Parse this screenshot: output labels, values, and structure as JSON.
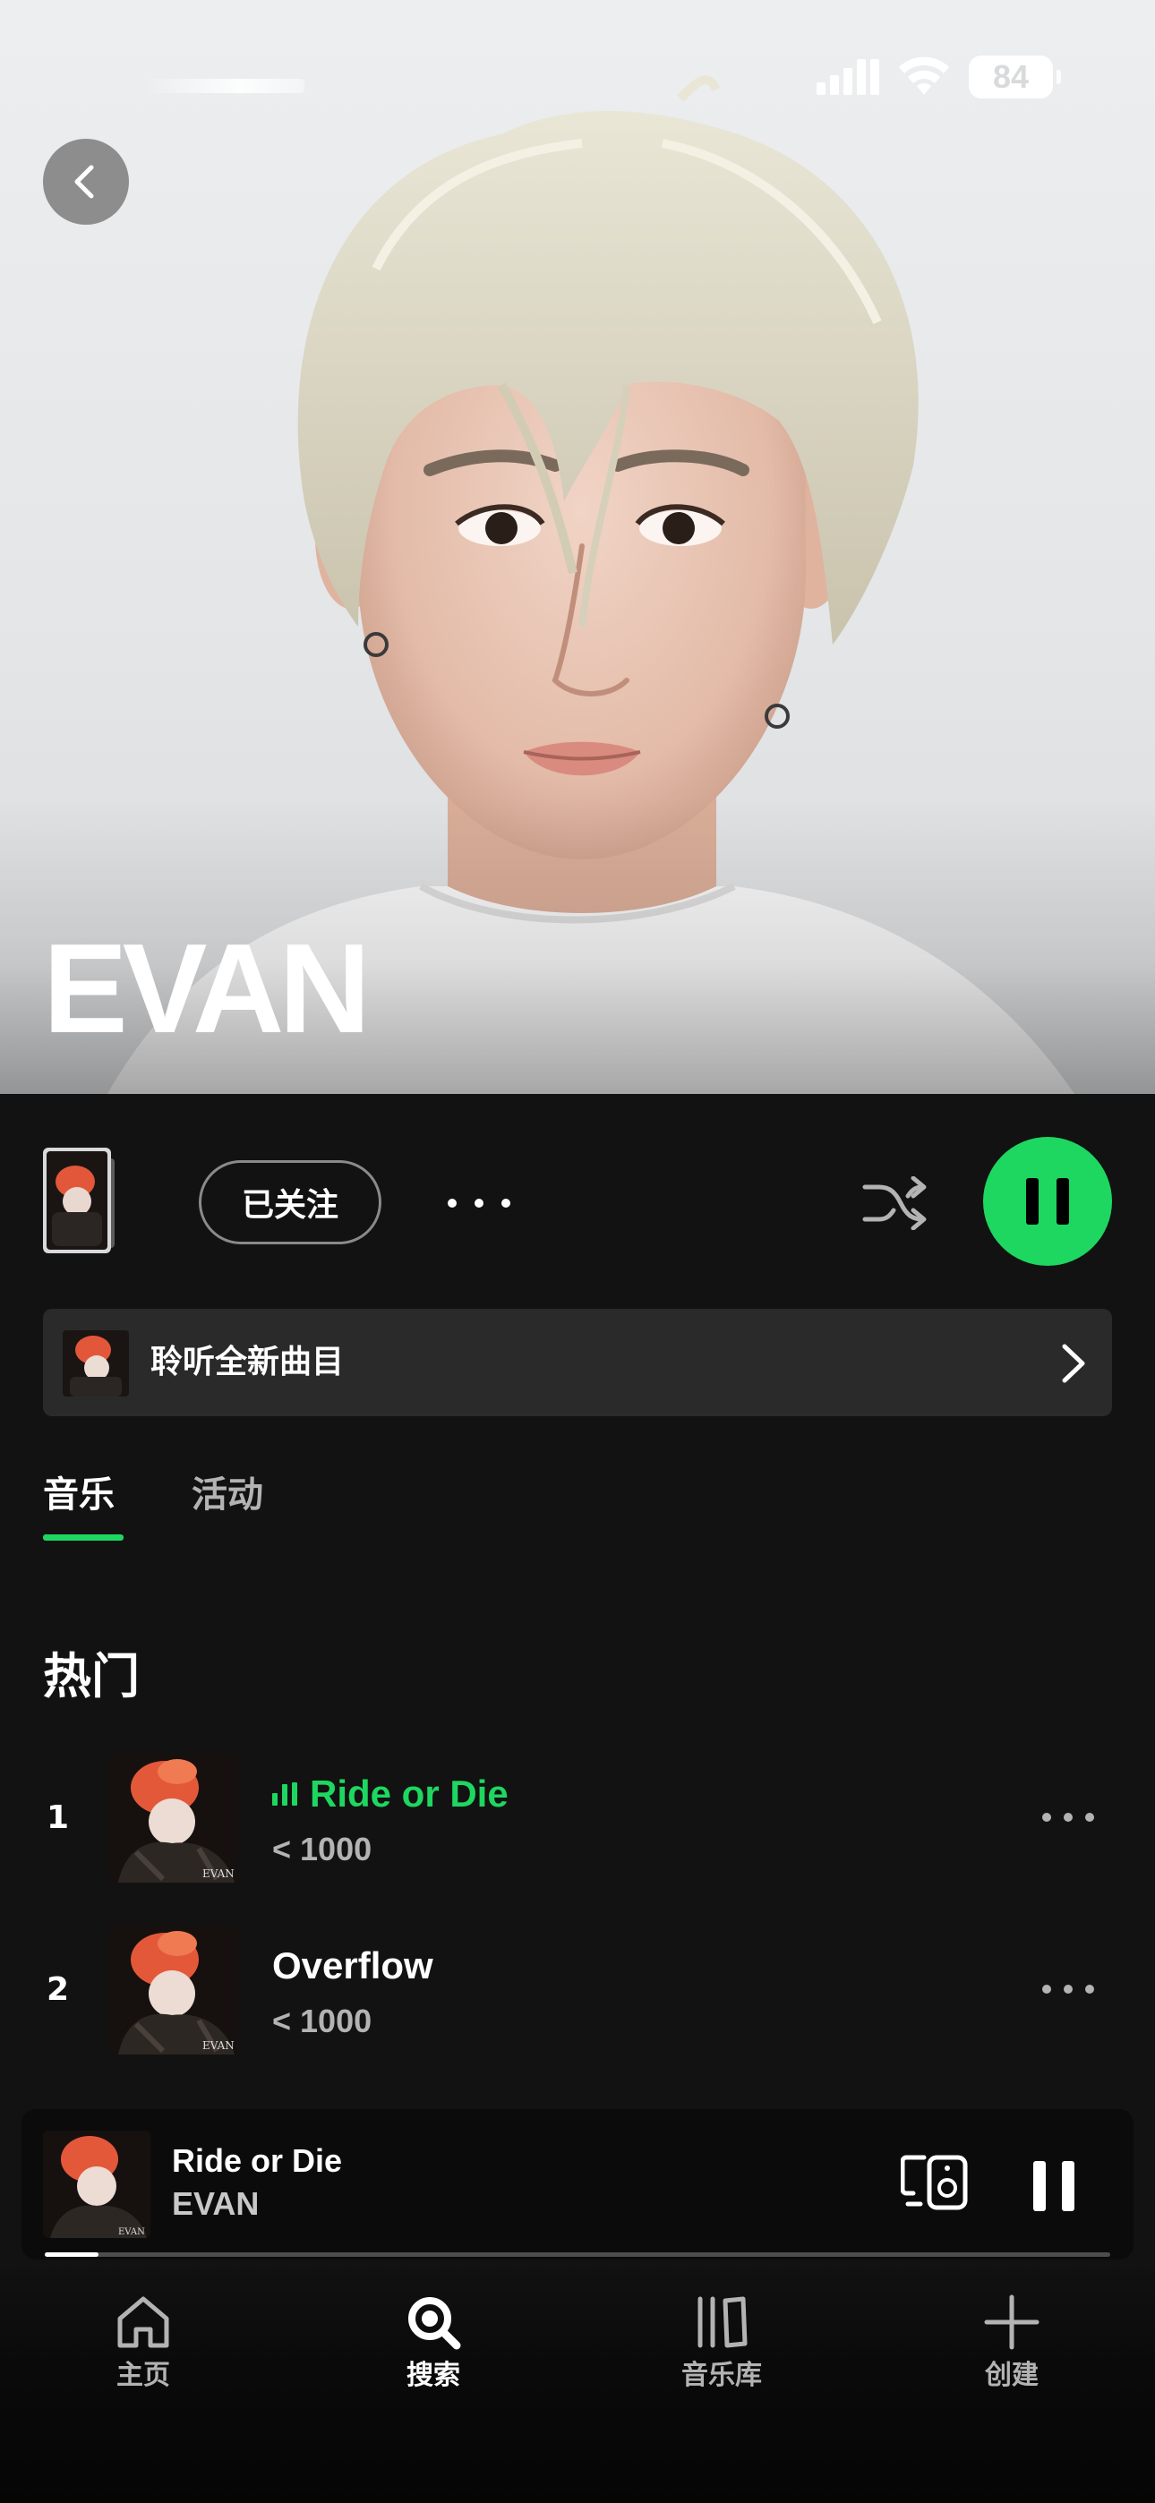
{
  "status_bar": {
    "battery": "84"
  },
  "artist": {
    "name": "EVAN"
  },
  "actions": {
    "follow_label": "已关注"
  },
  "new_release": {
    "label": "聆听全新曲目"
  },
  "tabs": [
    {
      "label": "音乐",
      "active": true
    },
    {
      "label": "活动",
      "active": false
    }
  ],
  "popular": {
    "title": "热门",
    "tracks": [
      {
        "rank": "1",
        "title": "Ride or Die",
        "plays": "< 1000",
        "now_playing": true
      },
      {
        "rank": "2",
        "title": "Overflow",
        "plays": "< 1000",
        "now_playing": false
      }
    ]
  },
  "now_playing": {
    "title": "Ride or Die",
    "artist": "EVAN",
    "progress": 0.05
  },
  "nav": {
    "home": "主页",
    "search": "搜索",
    "library": "音乐库",
    "create": "创建"
  },
  "colors": {
    "accent": "#1ed760",
    "background": "#121212",
    "card": "#2a2a2a"
  }
}
